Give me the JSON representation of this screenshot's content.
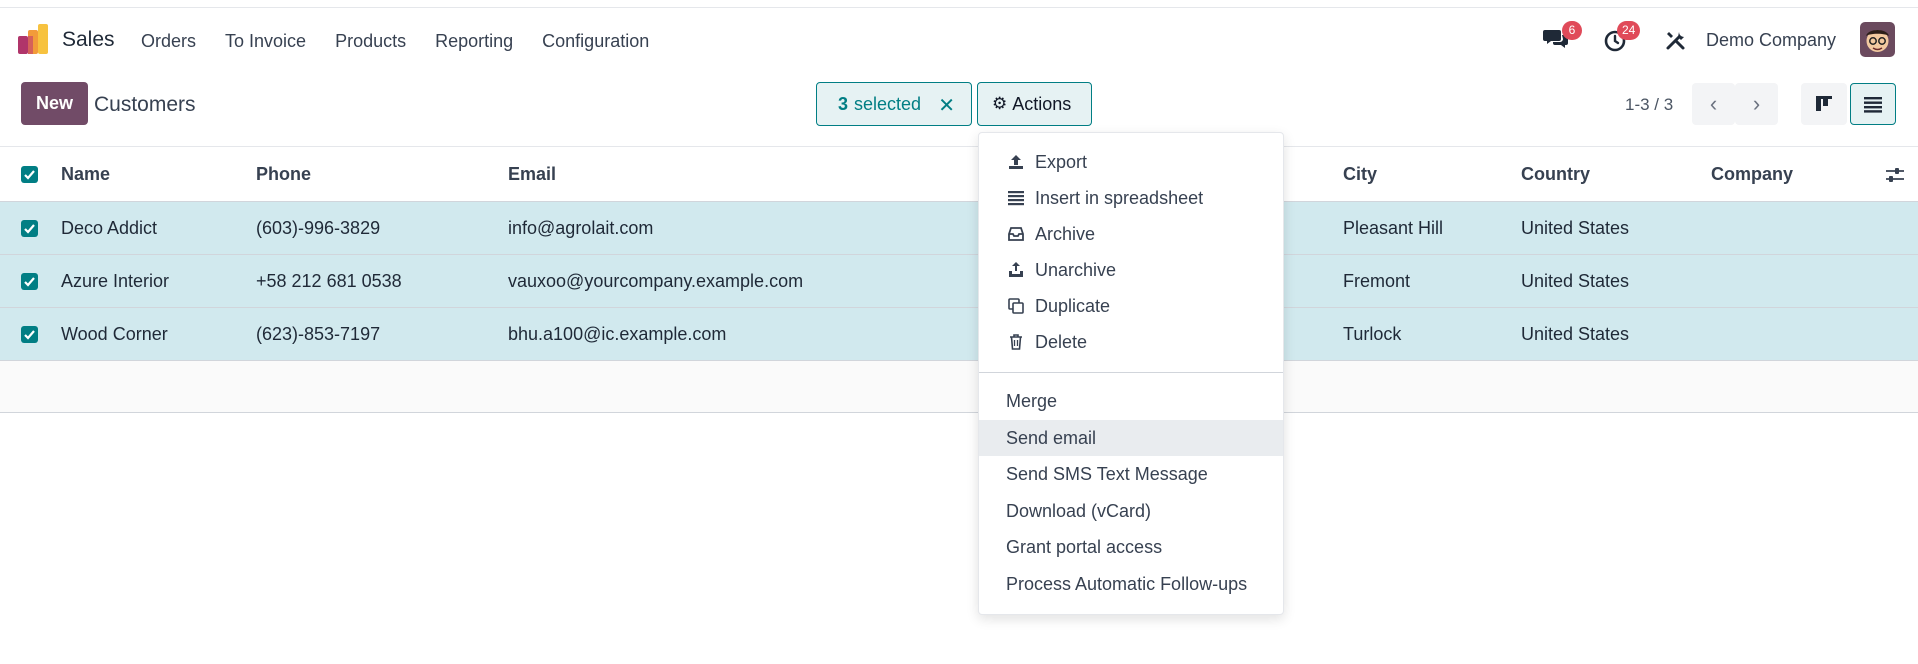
{
  "navbar": {
    "app_name": "Sales",
    "menu": [
      "Orders",
      "To Invoice",
      "Products",
      "Reporting",
      "Configuration"
    ],
    "messages_badge": "6",
    "activities_badge": "24",
    "company": "Demo Company"
  },
  "control": {
    "new_label": "New",
    "title": "Customers",
    "selected_count": "3",
    "selected_label": "selected",
    "actions_label": "Actions",
    "pager": "1-3 / 3"
  },
  "table": {
    "columns": {
      "name": "Name",
      "phone": "Phone",
      "email": "Email",
      "city": "City",
      "country": "Country",
      "company": "Company"
    },
    "rows": [
      {
        "name": "Deco Addict",
        "phone": "(603)-996-3829",
        "email": "info@agrolait.com",
        "city": "Pleasant Hill",
        "country": "United States",
        "company": ""
      },
      {
        "name": "Azure Interior",
        "phone": "+58 212 681 0538",
        "email": "vauxoo@yourcompany.example.com",
        "city": "Fremont",
        "country": "United States",
        "company": ""
      },
      {
        "name": "Wood Corner",
        "phone": "(623)-853-7197",
        "email": "bhu.a100@ic.example.com",
        "city": "Turlock",
        "country": "United States",
        "company": ""
      }
    ]
  },
  "actions_menu": {
    "icon_items": [
      {
        "label": "Export",
        "icon": "upload-icon"
      },
      {
        "label": "Insert in spreadsheet",
        "icon": "list-icon"
      },
      {
        "label": "Archive",
        "icon": "inbox-icon"
      },
      {
        "label": "Unarchive",
        "icon": "unarchive-icon"
      },
      {
        "label": "Duplicate",
        "icon": "copy-icon"
      },
      {
        "label": "Delete",
        "icon": "trash-icon"
      }
    ],
    "plain_items": [
      "Merge",
      "Send email",
      "Send SMS Text Message",
      "Download (vCard)",
      "Grant portal access",
      "Process Automatic Follow-ups"
    ],
    "hovered_item": "Send email"
  },
  "colors": {
    "primary": "#714b67",
    "accent": "#017e84",
    "selected_row": "#d1e9ee",
    "badge": "#e04a59"
  }
}
